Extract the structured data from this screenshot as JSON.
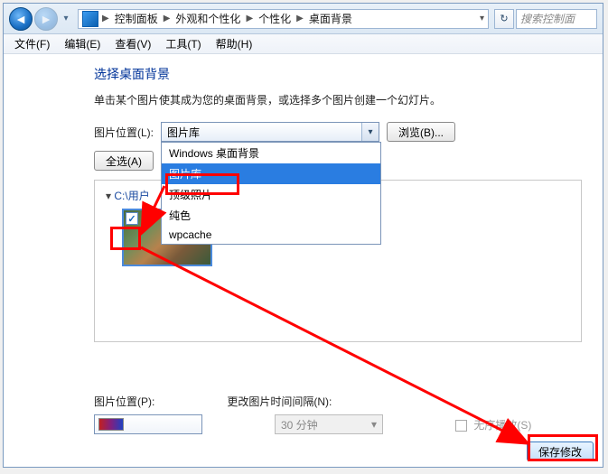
{
  "nav": {
    "crumbs": [
      "控制面板",
      "外观和个性化",
      "个性化",
      "桌面背景"
    ],
    "refresh_tip": "↻",
    "search_placeholder": "搜索控制面"
  },
  "menu": {
    "file": "文件(F)",
    "edit": "编辑(E)",
    "view": "查看(V)",
    "tools": "工具(T)",
    "help": "帮助(H)"
  },
  "main": {
    "title": "选择桌面背景",
    "subtitle": "单击某个图片使其成为您的桌面背景，或选择多个图片创建一个幻灯片。",
    "loc_label": "图片位置(L):",
    "combo_value": "图片库",
    "browse_label": "浏览(B)...",
    "select_all_label": "全选(A)",
    "tree_root": "C:\\用户",
    "dropdown": {
      "items": [
        "Windows 桌面背景",
        "图片库",
        "顶级照片",
        "纯色",
        "wpcache"
      ],
      "selected_index": 1
    }
  },
  "footer": {
    "pos_label": "图片位置(P):",
    "interval_label": "更改图片时间间隔(N):",
    "interval_value": "30 分钟",
    "shuffle_label": "无序播放(S)",
    "save_label": "保存修改"
  }
}
